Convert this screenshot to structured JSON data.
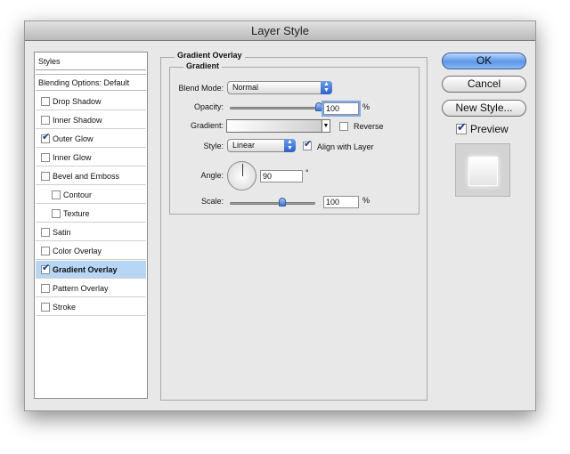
{
  "window": {
    "title": "Layer Style"
  },
  "styles_panel": {
    "header": "Styles",
    "blending_options": "Blending Options: Default",
    "items": [
      {
        "label": "Drop Shadow",
        "checked": false,
        "indent": false,
        "selected": false
      },
      {
        "label": "Inner Shadow",
        "checked": false,
        "indent": false,
        "selected": false
      },
      {
        "label": "Outer Glow",
        "checked": true,
        "indent": false,
        "selected": false
      },
      {
        "label": "Inner Glow",
        "checked": false,
        "indent": false,
        "selected": false
      },
      {
        "label": "Bevel and Emboss",
        "checked": false,
        "indent": false,
        "selected": false
      },
      {
        "label": "Contour",
        "checked": false,
        "indent": true,
        "selected": false
      },
      {
        "label": "Texture",
        "checked": false,
        "indent": true,
        "selected": false
      },
      {
        "label": "Satin",
        "checked": false,
        "indent": false,
        "selected": false
      },
      {
        "label": "Color Overlay",
        "checked": false,
        "indent": false,
        "selected": false
      },
      {
        "label": "Gradient Overlay",
        "checked": true,
        "indent": false,
        "selected": true
      },
      {
        "label": "Pattern Overlay",
        "checked": false,
        "indent": false,
        "selected": false
      },
      {
        "label": "Stroke",
        "checked": false,
        "indent": false,
        "selected": false
      }
    ]
  },
  "gradient_overlay": {
    "section_title": "Gradient Overlay",
    "group_title": "Gradient",
    "blend_mode_label": "Blend Mode:",
    "blend_mode_value": "Normal",
    "opacity_label": "Opacity:",
    "opacity_value": "100",
    "opacity_unit": "%",
    "opacity_level": 1.0,
    "gradient_label": "Gradient:",
    "reverse_label": "Reverse",
    "reverse_checked": false,
    "style_label": "Style:",
    "style_value": "Linear",
    "align_label": "Align with Layer",
    "align_checked": true,
    "angle_label": "Angle:",
    "angle_value": "90",
    "angle_unit": "°",
    "scale_label": "Scale:",
    "scale_value": "100",
    "scale_unit": "%",
    "scale_level": 0.6
  },
  "buttons": {
    "ok": "OK",
    "cancel": "Cancel",
    "new_style": "New Style...",
    "preview_label": "Preview",
    "preview_checked": true
  },
  "colors": {
    "accent": "#5c97e8",
    "selection": "#b7d5f5"
  }
}
